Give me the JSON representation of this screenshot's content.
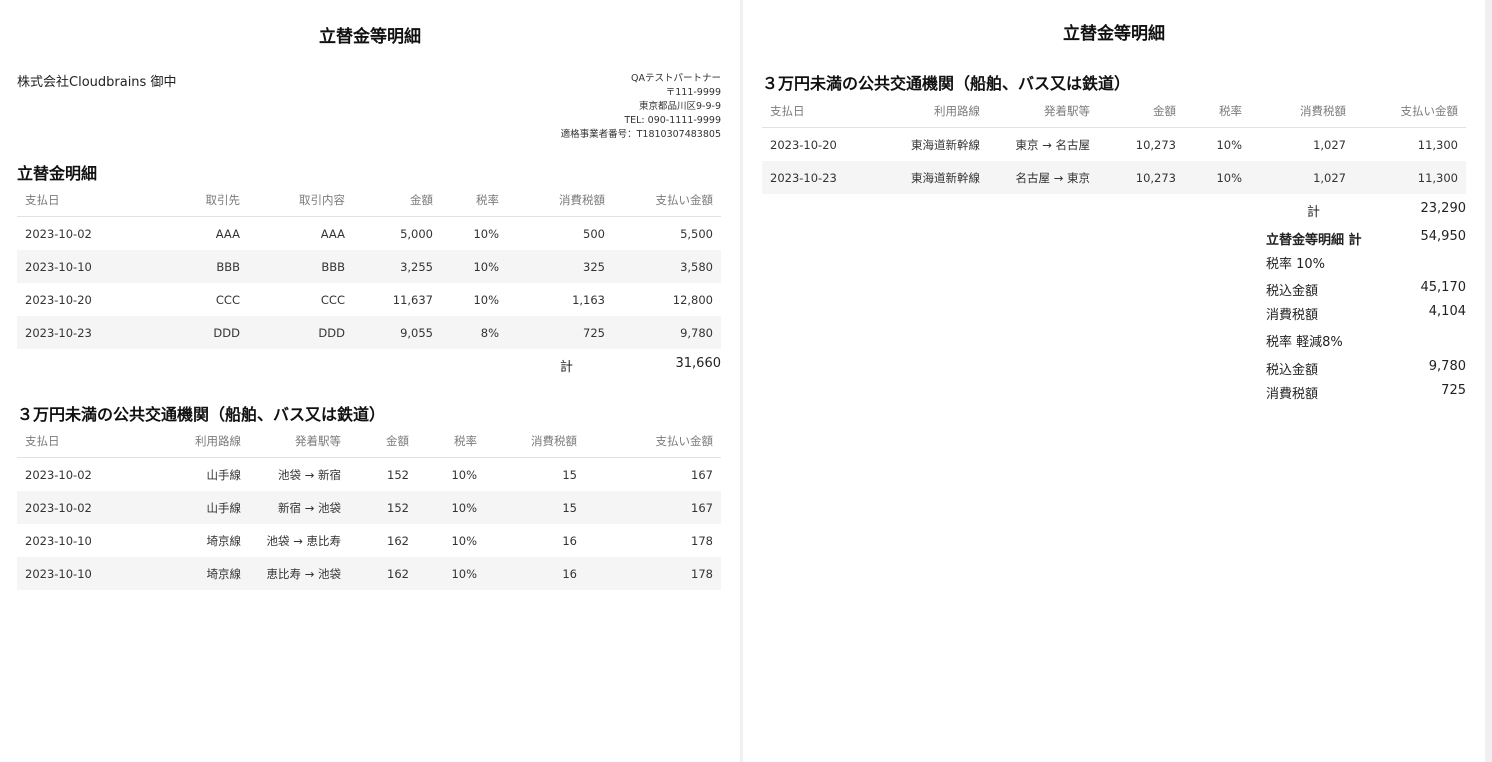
{
  "title": "立替金等明細",
  "recipient": "株式会社Cloudbrains 御中",
  "issuer": {
    "name": "QAテストパートナー",
    "postal": "〒111-9999",
    "address": "東京都品川区9-9-9",
    "tel": "TEL: 090-1111-9999",
    "reg": "適格事業者番号：T1810307483805"
  },
  "advance": {
    "title": "立替金明細",
    "headers": [
      "支払日",
      "取引先",
      "取引内容",
      "金額",
      "税率",
      "消費税額",
      "支払い金額"
    ],
    "rows": [
      [
        "2023-10-02",
        "AAA",
        "AAA",
        "5,000",
        "10%",
        "500",
        "5,500"
      ],
      [
        "2023-10-10",
        "BBB",
        "BBB",
        "3,255",
        "10%",
        "325",
        "3,580"
      ],
      [
        "2023-10-20",
        "CCC",
        "CCC",
        "11,637",
        "10%",
        "1,163",
        "12,800"
      ],
      [
        "2023-10-23",
        "DDD",
        "DDD",
        "9,055",
        "8%",
        "725",
        "9,780"
      ]
    ],
    "total_label": "計",
    "total_value": "31,660"
  },
  "transport": {
    "title": "３万円未満の公共交通機関（船舶、バス又は鉄道）",
    "headers": [
      "支払日",
      "利用路線",
      "発着駅等",
      "金額",
      "税率",
      "消費税額",
      "支払い金額"
    ],
    "rows_page1": [
      [
        "2023-10-02",
        "山手線",
        "池袋 → 新宿",
        "152",
        "10%",
        "15",
        "167"
      ],
      [
        "2023-10-02",
        "山手線",
        "新宿 → 池袋",
        "152",
        "10%",
        "15",
        "167"
      ],
      [
        "2023-10-10",
        "埼京線",
        "池袋 → 恵比寿",
        "162",
        "10%",
        "16",
        "178"
      ],
      [
        "2023-10-10",
        "埼京線",
        "恵比寿 → 池袋",
        "162",
        "10%",
        "16",
        "178"
      ]
    ],
    "rows_page2": [
      [
        "2023-10-20",
        "東海道新幹線",
        "東京 → 名古屋",
        "10,273",
        "10%",
        "1,027",
        "11,300"
      ],
      [
        "2023-10-23",
        "東海道新幹線",
        "名古屋 → 東京",
        "10,273",
        "10%",
        "1,027",
        "11,300"
      ]
    ],
    "total_label": "計",
    "total_value": "23,290"
  },
  "summary": {
    "grand_label": "立替金等明細 計",
    "grand_value": "54,950",
    "rate10_label": "税率 10%",
    "rate10_incl_label": "税込金額",
    "rate10_incl_value": "45,170",
    "rate10_tax_label": "消費税額",
    "rate10_tax_value": "4,104",
    "rate8_label": "税率 軽減8%",
    "rate8_incl_label": "税込金額",
    "rate8_incl_value": "9,780",
    "rate8_tax_label": "消費税額",
    "rate8_tax_value": "725"
  }
}
